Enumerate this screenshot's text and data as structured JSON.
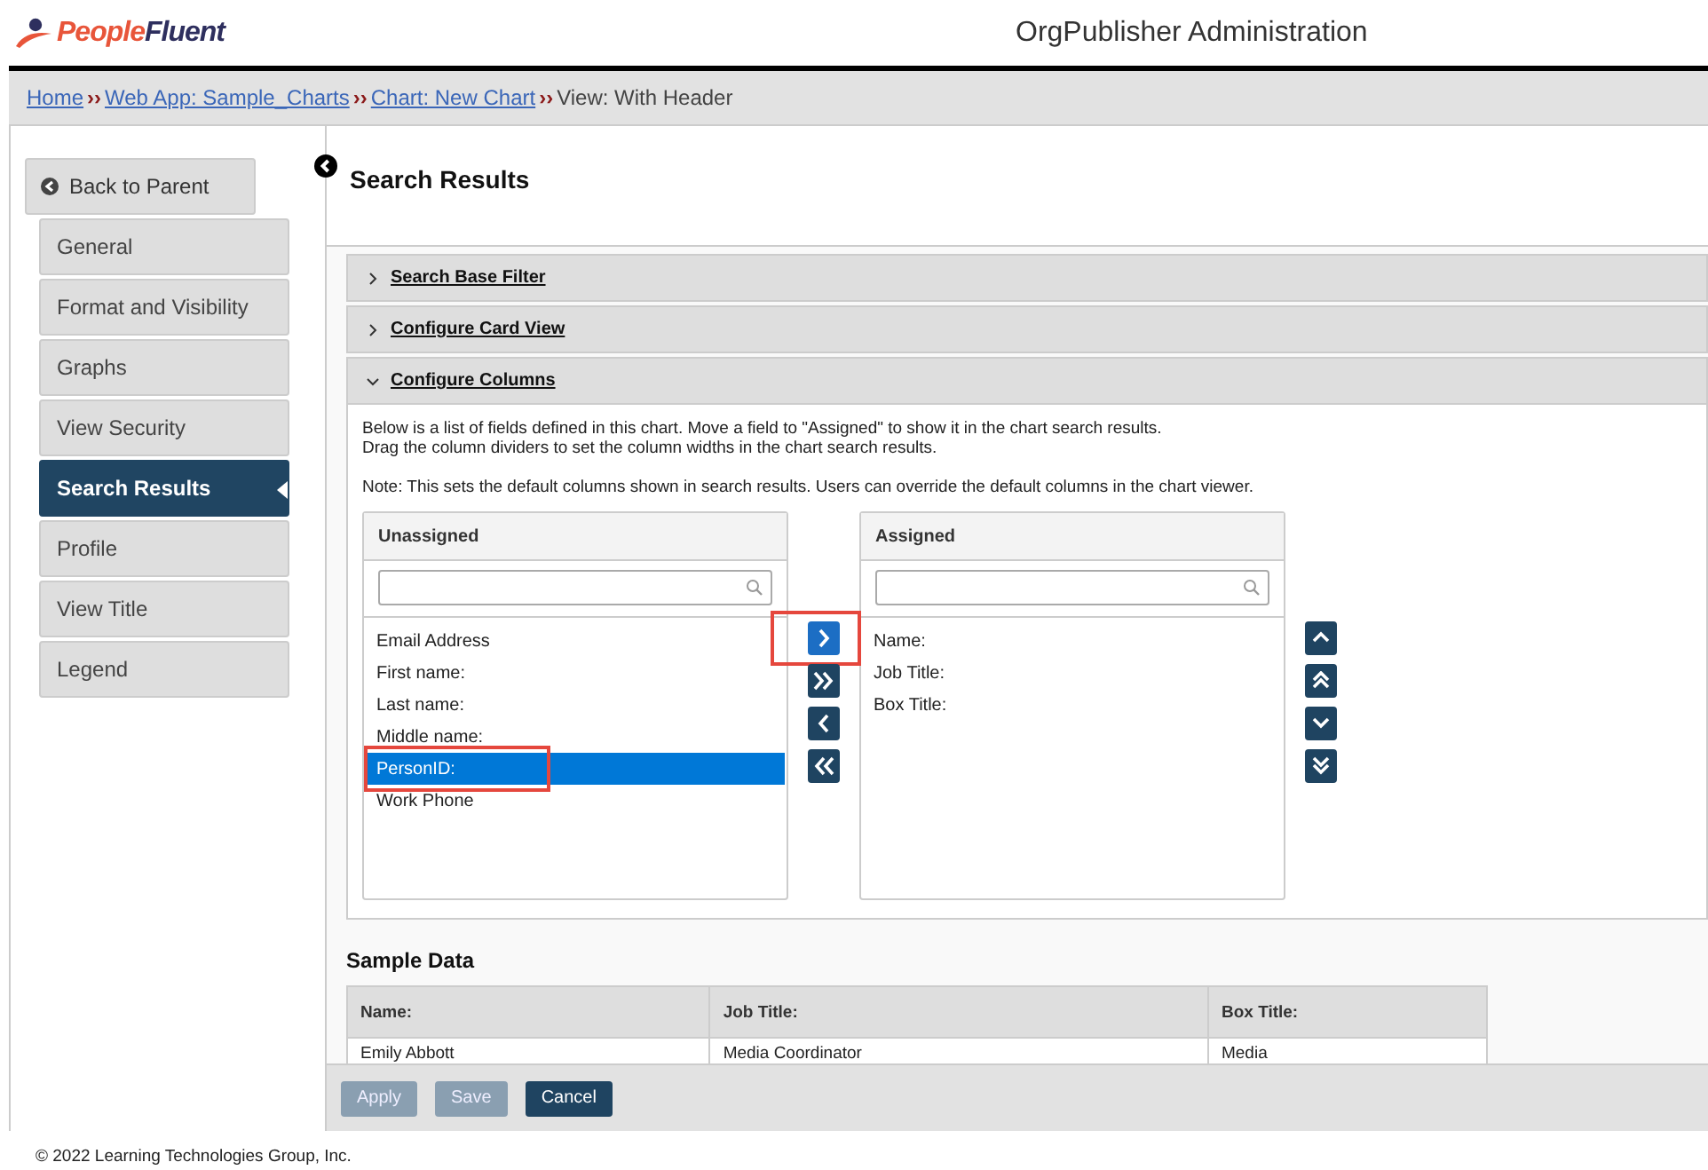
{
  "header": {
    "logo": {
      "first": "People",
      "second": "Fluent"
    },
    "title": "OrgPublisher Administration"
  },
  "breadcrumb": [
    {
      "label": "Home",
      "kind": "link",
      "separator": "››"
    },
    {
      "label": "Web App: Sample_Charts",
      "kind": "link",
      "separator": "››"
    },
    {
      "label": "Chart: New Chart",
      "kind": "link",
      "separator": "››"
    },
    {
      "label": "View: With Header",
      "kind": "current"
    }
  ],
  "sidebar": {
    "back_button": "Back to Parent",
    "items": [
      {
        "label": "General",
        "selected": false
      },
      {
        "label": "Format and Visibility",
        "selected": false
      },
      {
        "label": "Graphs",
        "selected": false
      },
      {
        "label": "View Security",
        "selected": false
      },
      {
        "label": "Search Results",
        "selected": true
      },
      {
        "label": "Profile",
        "selected": false
      },
      {
        "label": "View Title",
        "selected": false
      },
      {
        "label": "Legend",
        "selected": false
      }
    ]
  },
  "page_title": "Search Results",
  "sections": [
    {
      "title": "Search Base Filter",
      "expanded": false
    },
    {
      "title": "Configure Card View",
      "expanded": false
    },
    {
      "title": "Configure Columns",
      "expanded": true
    }
  ],
  "configure_columns": {
    "description": [
      "Below is a list of fields defined in this chart. Move a field to \"Assigned\" to show it in the chart search results.",
      "Drag the column dividers to set the column widths in the chart search results."
    ],
    "note": "Note: This sets the default columns shown in search results. Users can override the default columns in the chart viewer.",
    "unassigned": {
      "title": "Unassigned",
      "items": [
        {
          "label": "Email Address",
          "selected": false,
          "highlighted": false
        },
        {
          "label": "First name:",
          "selected": false,
          "highlighted": false
        },
        {
          "label": "Last name:",
          "selected": false,
          "highlighted": false
        },
        {
          "label": "Middle name:",
          "selected": false,
          "highlighted": false
        },
        {
          "label": "PersonID:",
          "selected": true,
          "highlighted": true
        },
        {
          "label": "Work Phone",
          "selected": false,
          "highlighted": false
        }
      ]
    },
    "move_buttons": [
      {
        "kind": "right",
        "active": true,
        "highlighted": true
      },
      {
        "kind": "all-right",
        "active": false,
        "highlighted": false
      },
      {
        "kind": "left",
        "active": false,
        "highlighted": false
      },
      {
        "kind": "all-left",
        "active": false,
        "highlighted": false
      }
    ],
    "assigned": {
      "title": "Assigned",
      "items": [
        {
          "label": "Name:",
          "selected": false,
          "highlighted": false
        },
        {
          "label": "Job Title:",
          "selected": false,
          "highlighted": false
        },
        {
          "label": "Box Title:",
          "selected": false,
          "highlighted": false
        }
      ]
    },
    "order_buttons": [
      {
        "kind": "up"
      },
      {
        "kind": "top"
      },
      {
        "kind": "down"
      },
      {
        "kind": "bottom"
      }
    ]
  },
  "sample_data": {
    "title": "Sample Data",
    "columns": [
      "Name:",
      "Job Title:",
      "Box Title:"
    ],
    "rows": [
      [
        "Emily Abbott",
        "Media Coordinator",
        "Media"
      ]
    ]
  },
  "actions": [
    {
      "label": "Apply",
      "disabled": true
    },
    {
      "label": "Save",
      "disabled": true
    },
    {
      "label": "Cancel",
      "disabled": false
    }
  ],
  "footer": "© 2022 Learning Technologies Group, Inc."
}
